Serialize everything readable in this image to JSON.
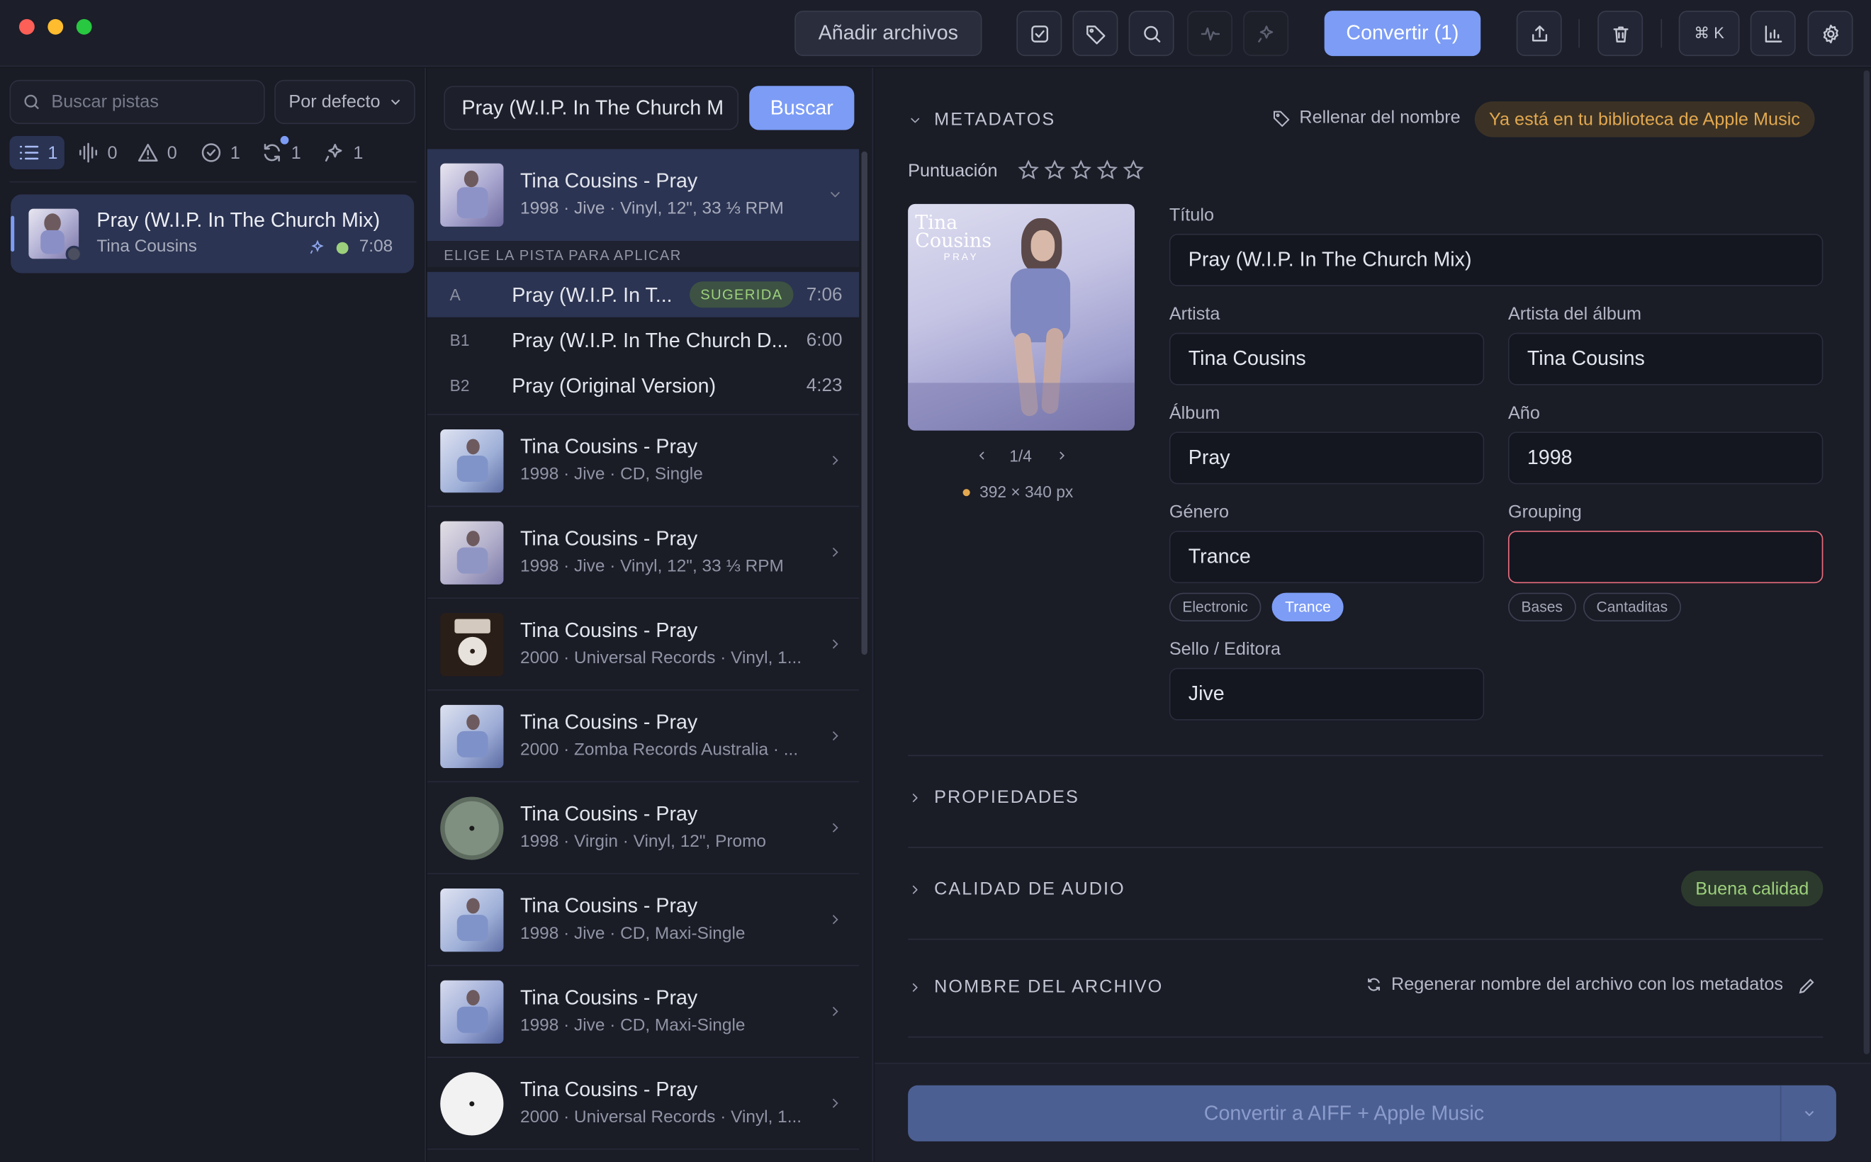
{
  "toolbar": {
    "add_files": "Añadir archivos",
    "convert": "Convertir (1)",
    "shortcut": "⌘ K"
  },
  "sidebar": {
    "search_placeholder": "Buscar pistas",
    "sort": "Por defecto",
    "filters": [
      {
        "icon": "list-icon",
        "count": "1"
      },
      {
        "icon": "waveform-icon",
        "count": "0"
      },
      {
        "icon": "warning-icon",
        "count": "0"
      },
      {
        "icon": "check-circle-icon",
        "count": "1"
      },
      {
        "icon": "sync-icon",
        "count": "1"
      },
      {
        "icon": "sparkle-icon",
        "count": "1"
      }
    ],
    "track": {
      "title": "Pray (W.I.P. In The Church Mix)",
      "artist": "Tina Cousins",
      "duration": "7:08"
    }
  },
  "middle": {
    "search_value": "Pray (W.I.P. In The Church M",
    "search_button": "Buscar",
    "selected": {
      "title": "Tina Cousins - Pray",
      "info": "1998 · Jive · Vinyl, 12\", 33 ⅓ RPM"
    },
    "choose_label": "ELIGE LA PISTA PARA APLICAR",
    "tracks": [
      {
        "pos": "A",
        "name": "Pray (W.I.P. In T...",
        "badge": "SUGERIDA",
        "dur": "7:06"
      },
      {
        "pos": "B1",
        "name": "Pray (W.I.P. In The Church D...",
        "dur": "6:00"
      },
      {
        "pos": "B2",
        "name": "Pray (Original Version)",
        "dur": "4:23"
      }
    ],
    "releases": [
      {
        "title": "Tina Cousins - Pray",
        "info": "1998 · Jive · CD, Single"
      },
      {
        "title": "Tina Cousins - Pray",
        "info": "1998 · Jive · Vinyl, 12\", 33 ⅓ RPM"
      },
      {
        "title": "Tina Cousins - Pray",
        "info": "2000 · Universal Records · Vinyl, 1..."
      },
      {
        "title": "Tina Cousins - Pray",
        "info": "2000 · Zomba Records Australia · ..."
      },
      {
        "title": "Tina Cousins - Pray",
        "info": "1998 · Virgin · Vinyl, 12\", Promo"
      },
      {
        "title": "Tina Cousins - Pray",
        "info": "1998 · Jive · CD, Maxi-Single"
      },
      {
        "title": "Tina Cousins - Pray",
        "info": "1998 · Jive · CD, Maxi-Single"
      },
      {
        "title": "Tina Cousins - Pray",
        "info": "2000 · Universal Records · Vinyl, 1..."
      }
    ]
  },
  "metadata": {
    "section": "METADATOS",
    "fill_from_name": "Rellenar del nombre",
    "library_badge": "Ya está en tu biblioteca de Apple Music",
    "rating_label": "Puntuación",
    "rating": 0,
    "art_caption": "Tina Cousins",
    "art_caption2": "P R A Y",
    "art_index": "1/4",
    "art_size": "392 × 340 px",
    "fields": {
      "title_label": "Título",
      "title": "Pray (W.I.P. In The Church Mix)",
      "artist_label": "Artista",
      "artist": "Tina Cousins",
      "album_artist_label": "Artista del álbum",
      "album_artist": "Tina Cousins",
      "album_label": "Álbum",
      "album": "Pray",
      "year_label": "Año",
      "year": "1998",
      "genre_label": "Género",
      "genre": "Trance",
      "grouping_label": "Grouping",
      "grouping": "",
      "label_label": "Sello / Editora",
      "label": "Jive"
    },
    "genre_suggestions": [
      "Electronic",
      "Trance"
    ],
    "grouping_suggestions": [
      "Bases",
      "Cantaditas"
    ]
  },
  "sections": {
    "properties": "PROPIEDADES",
    "audio_quality": "CALIDAD DE AUDIO",
    "quality_badge": "Buena calidad",
    "filename": "NOMBRE DEL ARCHIVO",
    "regenerate": "Regenerar nombre del archivo con los metadatos"
  },
  "footer": {
    "convert_button": "Convertir a AIFF + Apple Music"
  },
  "colors": {
    "accent": "#7c9cf5",
    "warning": "#e3a84f",
    "success": "#9dd07c",
    "error": "#e76d7d"
  }
}
